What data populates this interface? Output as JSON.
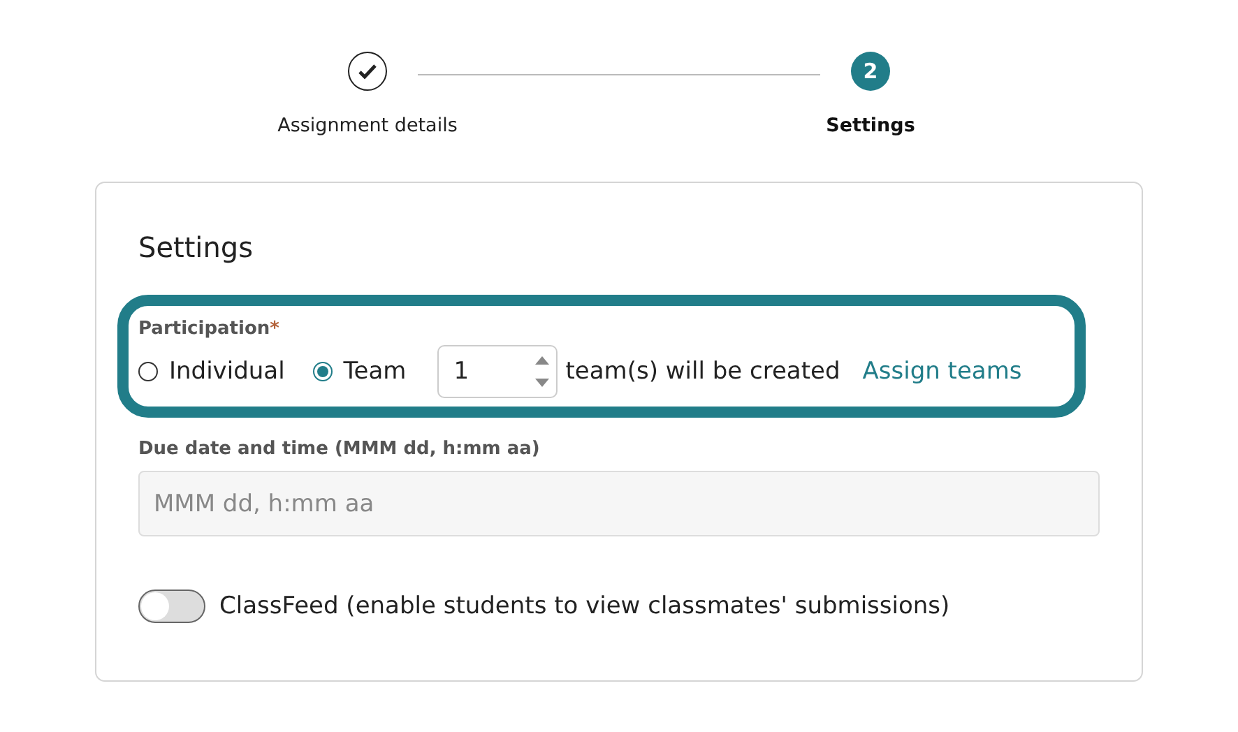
{
  "stepper": {
    "steps": [
      {
        "kind": "done",
        "label": "Assignment details",
        "selected": false
      },
      {
        "kind": "current",
        "number": "2",
        "label": "Settings",
        "selected": true
      }
    ]
  },
  "card": {
    "title": "Settings",
    "participation": {
      "label": "Participation",
      "required_mark": "*",
      "options": [
        {
          "label": "Individual",
          "selected": false
        },
        {
          "label": "Team",
          "selected": true
        }
      ],
      "team_count": "1",
      "team_text": "team(s) will be created",
      "link": "Assign teams"
    },
    "due_date": {
      "label": "Due date and time (MMM dd, h:mm aa)",
      "placeholder": "MMM dd, h:mm aa"
    },
    "classfeed": {
      "label": "ClassFeed (enable students to view classmates' submissions)",
      "on": false
    }
  }
}
